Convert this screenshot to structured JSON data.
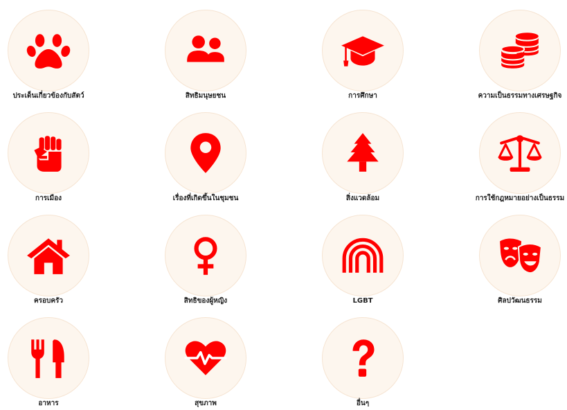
{
  "accent_color": "#ff0000",
  "circle_color": "#fdf6ee",
  "categories": [
    {
      "label": "ประเด็นเกี่ยวข้องกับสัตว์",
      "icon": "paw-icon"
    },
    {
      "label": "สิทธิมนุษยชน",
      "icon": "users-icon"
    },
    {
      "label": "การศึกษา",
      "icon": "graduation-cap-icon"
    },
    {
      "label": "ความเป็นธรรมทางเศรษฐกิจ",
      "icon": "coins-icon"
    },
    {
      "label": "การเมือง",
      "icon": "fist-icon"
    },
    {
      "label": "เรื่องที่เกิดขึ้นในชุมชน",
      "icon": "map-marker-icon"
    },
    {
      "label": "สิ่งแวดล้อม",
      "icon": "tree-icon"
    },
    {
      "label": "การใช้กฎหมายอย่างเป็นธรรม",
      "icon": "balance-scale-icon"
    },
    {
      "label": "ครอบครัว",
      "icon": "home-icon"
    },
    {
      "label": "สิทธิของผู้หญิง",
      "icon": "venus-icon"
    },
    {
      "label": "LGBT",
      "icon": "rainbow-icon"
    },
    {
      "label": "ศิลปวัฒนธรรม",
      "icon": "theater-masks-icon"
    },
    {
      "label": "อาหาร",
      "icon": "utensils-icon"
    },
    {
      "label": "สุขภาพ",
      "icon": "heartbeat-icon"
    },
    {
      "label": "อื่นๆ",
      "icon": "question-icon"
    }
  ]
}
